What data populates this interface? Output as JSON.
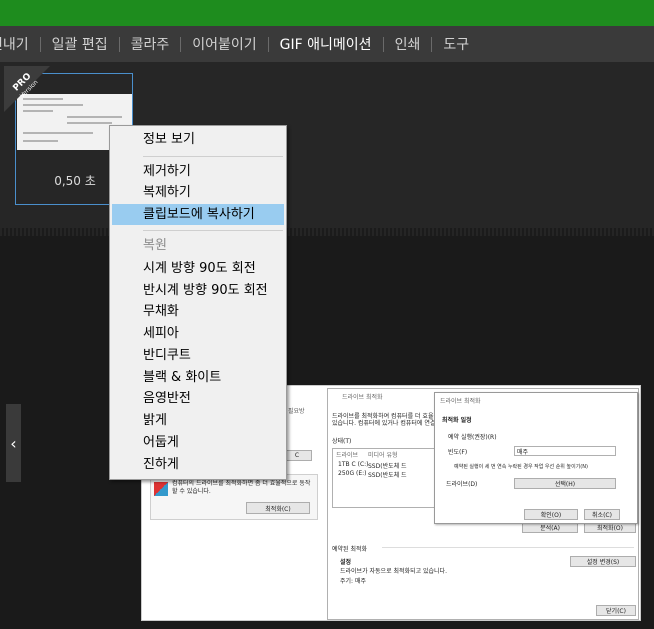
{
  "menubar": {
    "items": [
      "견내기",
      "일괄 편집",
      "콜라주",
      "이어붙이기",
      "GIF 애니메이션",
      "인쇄",
      "도구"
    ],
    "active_index": 4
  },
  "badge": {
    "main": "PRO",
    "sub": "Version"
  },
  "frame": {
    "time": "0,50 초"
  },
  "context_menu": {
    "items": [
      {
        "label": "정보 보기",
        "state": "normal"
      },
      {
        "label": "제거하기",
        "state": "normal"
      },
      {
        "label": "복제하기",
        "state": "normal"
      },
      {
        "label": "클립보드에 복사하기",
        "state": "highlighted"
      },
      {
        "label": "복원",
        "state": "disabled"
      },
      {
        "label": "시계 방향 90도 회전",
        "state": "normal"
      },
      {
        "label": "반시계 방향 90도 회전",
        "state": "normal"
      },
      {
        "label": "무채화",
        "state": "normal"
      },
      {
        "label": "세피아",
        "state": "normal"
      },
      {
        "label": "반디쿠트",
        "state": "normal"
      },
      {
        "label": "블랙 & 화이트",
        "state": "normal"
      },
      {
        "label": "음영반전",
        "state": "normal"
      },
      {
        "label": "밝게",
        "state": "normal"
      },
      {
        "label": "어둡게",
        "state": "normal"
      },
      {
        "label": "진하게",
        "state": "normal"
      }
    ]
  },
  "nav": {
    "left_arrow": "‹"
  },
  "preview": {
    "left_title": "필요방",
    "left_btn1": "C",
    "left_desc": "컴퓨터의 드라이브를 최적화하면 좀 더 효율적으로 동작할 수 있습니다.",
    "left_btn2": "최적화(C)",
    "mid_title": "드라이브 최적화",
    "mid_desc1": "드라이브를 최적화하여 컴퓨터를 더 효율",
    "mid_desc2": "있습니다. 컴퓨터에 있거나 컴퓨터에 연결",
    "status_label": "상태(T)",
    "col_drive": "드라이브",
    "col_media": "미디어 유형",
    "drive1": "1TB C (C:)",
    "drive1_media": "SSD(반도체 드",
    "drive2": "250G (E:)",
    "drive2_media": "SSD(반도체 드",
    "mid_btn_analyze": "분석(A)",
    "mid_btn_optimize": "최적화(O)",
    "scheduled_label": "예약된 최적화",
    "settings_label": "설정",
    "settings_desc": "드라이브가 자동으로 최적화되고 있습니다.",
    "freq_desc": "주기: 매주",
    "settings_btn": "설정 변경(S)",
    "close_btn": "닫기(C)",
    "dialog_title": "드라이브 최적화",
    "dialog_heading": "최적화 일정",
    "dialog_check1": "예약 실행(권장)(R)",
    "dialog_freq_label": "빈도(F)",
    "dialog_freq_value": "매주",
    "dialog_check2": "예약된 실행이 세 번 연속 누락된 경우 작업 우선 순위 높이기(N)",
    "dialog_drive_label": "드라이브(D)",
    "dialog_select_btn": "선택(H)",
    "dialog_ok": "확인(O)",
    "dialog_cancel": "취소(C)"
  }
}
